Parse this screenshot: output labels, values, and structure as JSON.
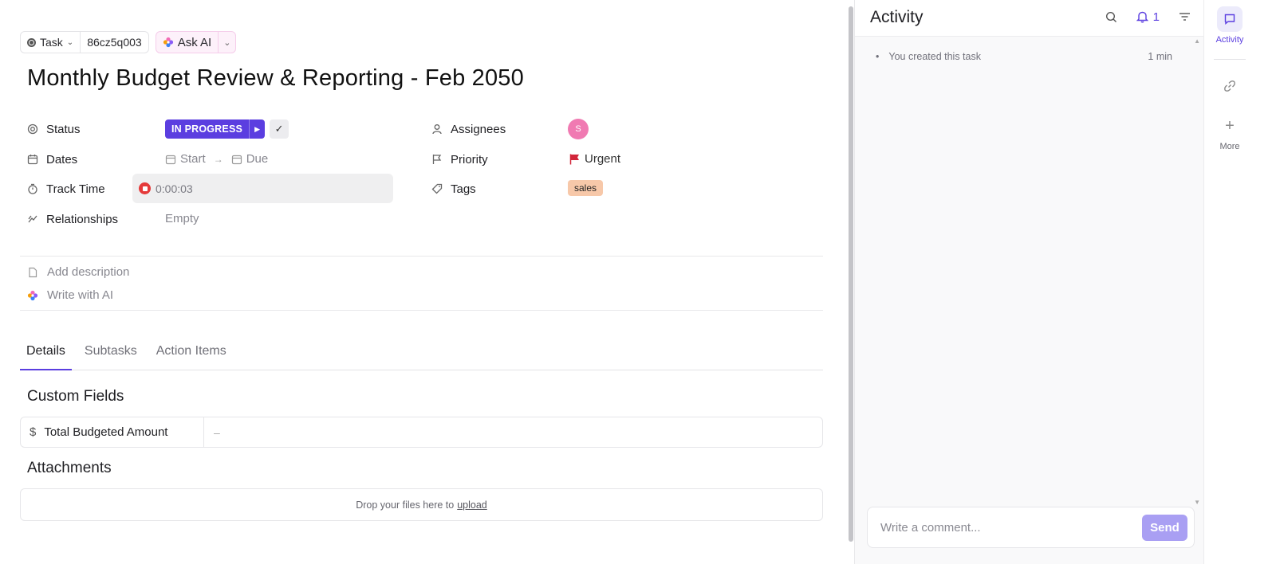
{
  "header": {
    "type_label": "Task",
    "task_id": "86cz5q003",
    "ask_ai_label": "Ask AI"
  },
  "task": {
    "title": "Monthly Budget Review & Reporting - Feb 2050"
  },
  "fields": {
    "status": {
      "label": "Status",
      "value": "IN PROGRESS",
      "color": "#5b3ee0"
    },
    "dates": {
      "label": "Dates",
      "start": "Start",
      "due": "Due"
    },
    "track_time": {
      "label": "Track Time",
      "value": "0:00:03"
    },
    "relationships": {
      "label": "Relationships",
      "value": "Empty"
    },
    "assignees": {
      "label": "Assignees",
      "avatar_initial": "S",
      "avatar_color": "#f07ab2"
    },
    "priority": {
      "label": "Priority",
      "value": "Urgent",
      "color": "#d2263a"
    },
    "tags": {
      "label": "Tags",
      "items": [
        "sales"
      ],
      "color": "#f7c8a9"
    }
  },
  "description": {
    "add_label": "Add description",
    "ai_label": "Write with AI"
  },
  "tabs": [
    {
      "label": "Details",
      "active": true
    },
    {
      "label": "Subtasks",
      "active": false
    },
    {
      "label": "Action Items",
      "active": false
    }
  ],
  "custom_fields": {
    "title": "Custom Fields",
    "rows": [
      {
        "icon": "dollar-icon",
        "name": "Total Budgeted Amount",
        "value": "–"
      }
    ]
  },
  "attachments": {
    "title": "Attachments",
    "drop_text": "Drop your files here to",
    "upload_link": "upload"
  },
  "activity": {
    "title": "Activity",
    "notification_count": "1",
    "items": [
      {
        "text": "You created this task",
        "time": "1 min"
      }
    ],
    "comment_placeholder": "Write a comment...",
    "send_label": "Send"
  },
  "rail": {
    "activity_label": "Activity",
    "more_label": "More"
  }
}
